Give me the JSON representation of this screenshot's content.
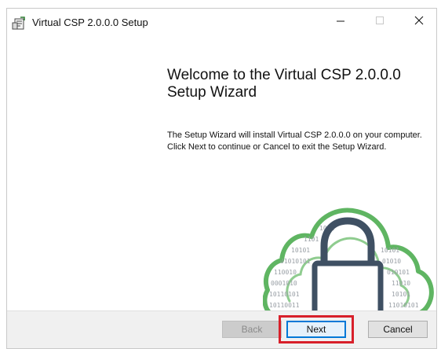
{
  "window": {
    "title": "Virtual CSP 2.0.0.0 Setup",
    "controls": {
      "minimize_icon": "minimize-icon",
      "maximize_icon": "maximize-icon",
      "close_icon": "close-icon"
    }
  },
  "wizard": {
    "heading": "Welcome to the Virtual CSP 2.0.0.0 Setup Wizard",
    "description": "The Setup Wizard will install Virtual CSP 2.0.0.0 on your computer. Click Next to continue or Cancel to exit the Setup Wizard.",
    "illustration": {
      "icons": [
        "cloud-icon",
        "padlock-icon"
      ],
      "binary_left": [
        "1011",
        "1101",
        "10101",
        "01010101",
        "110010",
        "0001010",
        "10110101",
        "10110011"
      ],
      "binary_right": [
        "10101",
        "01010",
        "010101",
        "11010",
        "10101",
        "11010101"
      ]
    }
  },
  "buttons": {
    "back_label": "Back",
    "next_label": "Next",
    "cancel_label": "Cancel"
  },
  "colors": {
    "cloud_green": "#5fb562",
    "padlock_navy": "#3f5063",
    "highlight_red": "#d8202a",
    "focus_blue": "#0078d7"
  }
}
